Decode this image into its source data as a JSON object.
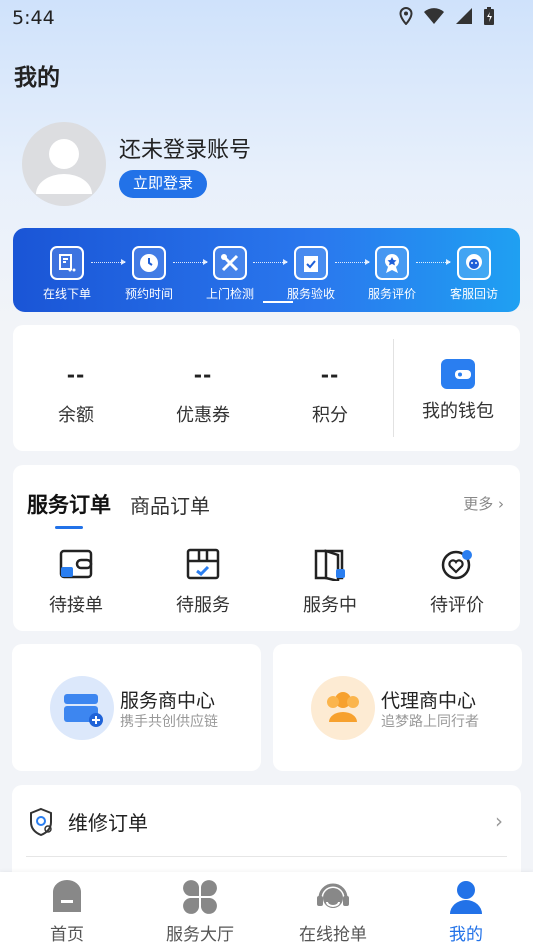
{
  "status_bar": {
    "time": "5:44"
  },
  "page": {
    "title": "我的"
  },
  "profile": {
    "name": "还未登录账号",
    "login_label": "立即登录"
  },
  "service_flow": {
    "steps": [
      {
        "label": "在线下单",
        "icon": "order-cart-icon"
      },
      {
        "label": "预约时间",
        "icon": "clock-icon"
      },
      {
        "label": "上门检测",
        "icon": "tools-icon"
      },
      {
        "label": "服务验收",
        "icon": "clipboard-check-icon"
      },
      {
        "label": "服务评价",
        "icon": "award-icon"
      },
      {
        "label": "客服回访",
        "icon": "support-agent-icon"
      }
    ]
  },
  "assets": {
    "items": [
      {
        "value": "--",
        "label": "余额"
      },
      {
        "value": "--",
        "label": "优惠券"
      },
      {
        "value": "--",
        "label": "积分"
      }
    ],
    "wallet_label": "我的钱包"
  },
  "orders": {
    "tab_service": "服务订单",
    "tab_goods": "商品订单",
    "more_label": "更多",
    "items": [
      {
        "label": "待接单",
        "icon": "wallet-card-icon"
      },
      {
        "label": "待服务",
        "icon": "calendar-board-icon"
      },
      {
        "label": "服务中",
        "icon": "door-icon"
      },
      {
        "label": "待评价",
        "icon": "heart-check-icon"
      }
    ]
  },
  "centers": {
    "provider": {
      "title": "服务商中心",
      "subtitle": "携手共创供应链"
    },
    "agent": {
      "title": "代理商中心",
      "subtitle": "追梦路上同行者"
    }
  },
  "repair": {
    "label": "维修订单"
  },
  "tabbar": {
    "items": [
      {
        "label": "首页",
        "icon": "home-icon"
      },
      {
        "label": "服务大厅",
        "icon": "grid-clover-icon"
      },
      {
        "label": "在线抢单",
        "icon": "headset-icon"
      },
      {
        "label": "我的",
        "icon": "person-icon"
      }
    ],
    "active_index": 3
  },
  "colors": {
    "accent": "#2272e8",
    "banner_start": "#1a55d6",
    "banner_end": "#1fa0f2"
  }
}
